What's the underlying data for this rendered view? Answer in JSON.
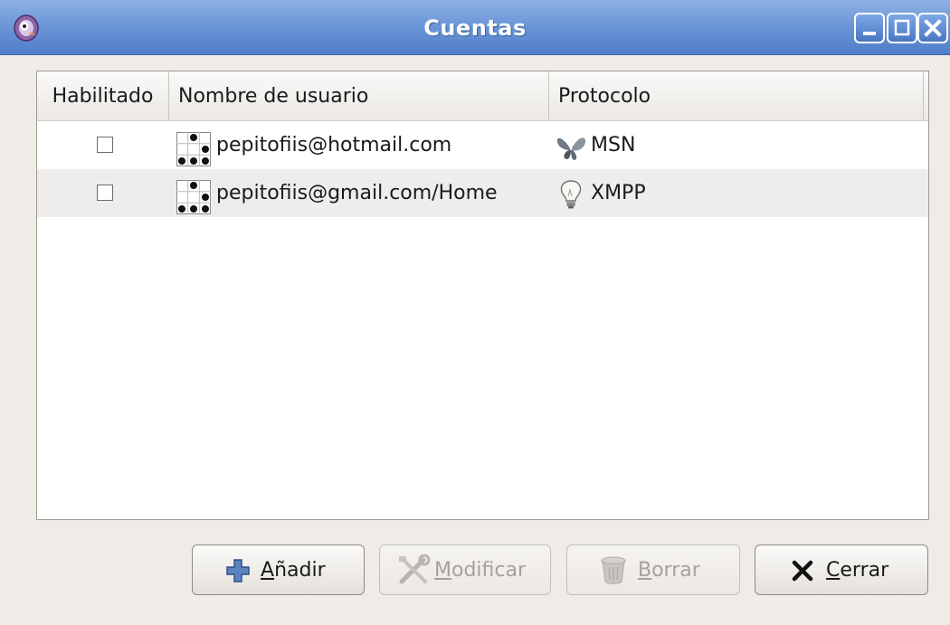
{
  "window": {
    "title": "Cuentas",
    "app_icon": "pidgin-icon",
    "controls": [
      "minimize-icon",
      "maximize-icon",
      "close-icon"
    ]
  },
  "accounts_table": {
    "columns": [
      "Habilitado",
      "Nombre de usuario",
      "Protocolo"
    ],
    "rows": [
      {
        "enabled": false,
        "username": "pepitofiis@hotmail.com",
        "user_icon": "buddy-icon",
        "protocol": "MSN",
        "protocol_icon": "msn-butterfly-icon"
      },
      {
        "enabled": false,
        "username": "pepitofiis@gmail.com/Home",
        "user_icon": "buddy-icon",
        "protocol": "XMPP",
        "protocol_icon": "xmpp-lightbulb-icon"
      }
    ]
  },
  "buttons": {
    "add": {
      "label": "Añadir",
      "mnemonic": "A",
      "rest": "ñadir",
      "enabled": true,
      "icon": "plus-icon"
    },
    "modify": {
      "label": "Modificar",
      "mnemonic": "M",
      "rest": "odificar",
      "enabled": false,
      "icon": "tools-icon"
    },
    "delete": {
      "label": "Borrar",
      "mnemonic": "B",
      "rest": "orrar",
      "enabled": false,
      "icon": "trash-icon"
    },
    "close": {
      "label": "Cerrar",
      "mnemonic": "C",
      "rest": "errar",
      "enabled": true,
      "icon": "x-icon"
    }
  },
  "colors": {
    "titlebar": "#6d97d8",
    "window_bg": "#efebe7",
    "alt_row": "#eeedeb"
  }
}
